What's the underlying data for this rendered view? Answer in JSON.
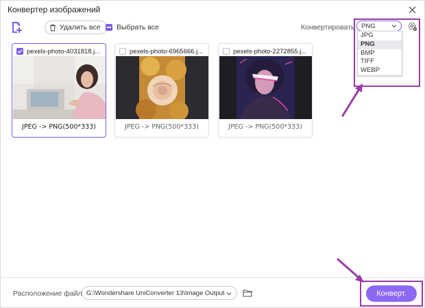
{
  "window": {
    "title": "Конвертер изображений"
  },
  "toolbar": {
    "delete_all_label": "Удалить все",
    "select_all_label": "Выбрать все",
    "convert_to_label": "Конвертировать в",
    "format_selected": "PNG"
  },
  "format_dropdown": {
    "options": [
      "JPG",
      "PNG",
      "BMP",
      "TIFF",
      "WEBP"
    ],
    "selected": "PNG"
  },
  "cards": [
    {
      "filename": "pexels-photo-4031818.j...",
      "conversion": "JPEG -> PNG(500*333)",
      "checked": true
    },
    {
      "filename": "pexels-photo-6965666.j...",
      "conversion": "JPEG -> PNG(500*333)",
      "checked": false
    },
    {
      "filename": "pexels-photo-2272855.j...",
      "conversion": "JPEG -> PNG(500*333)",
      "checked": false
    }
  ],
  "footer": {
    "location_label": "Расположение файла:",
    "output_path": "G:\\Wondershare UniConverter 13\\Image Output",
    "convert_label": "Конверт."
  },
  "colors": {
    "accent": "#7c5cf0",
    "button": "#8d68f2",
    "annotation": "#9b3aa8"
  },
  "icons": [
    "close-icon",
    "add-file-icon",
    "trash-icon",
    "chevron-down-icon",
    "settings-gear-icon",
    "folder-icon",
    "checkmark-icon"
  ]
}
